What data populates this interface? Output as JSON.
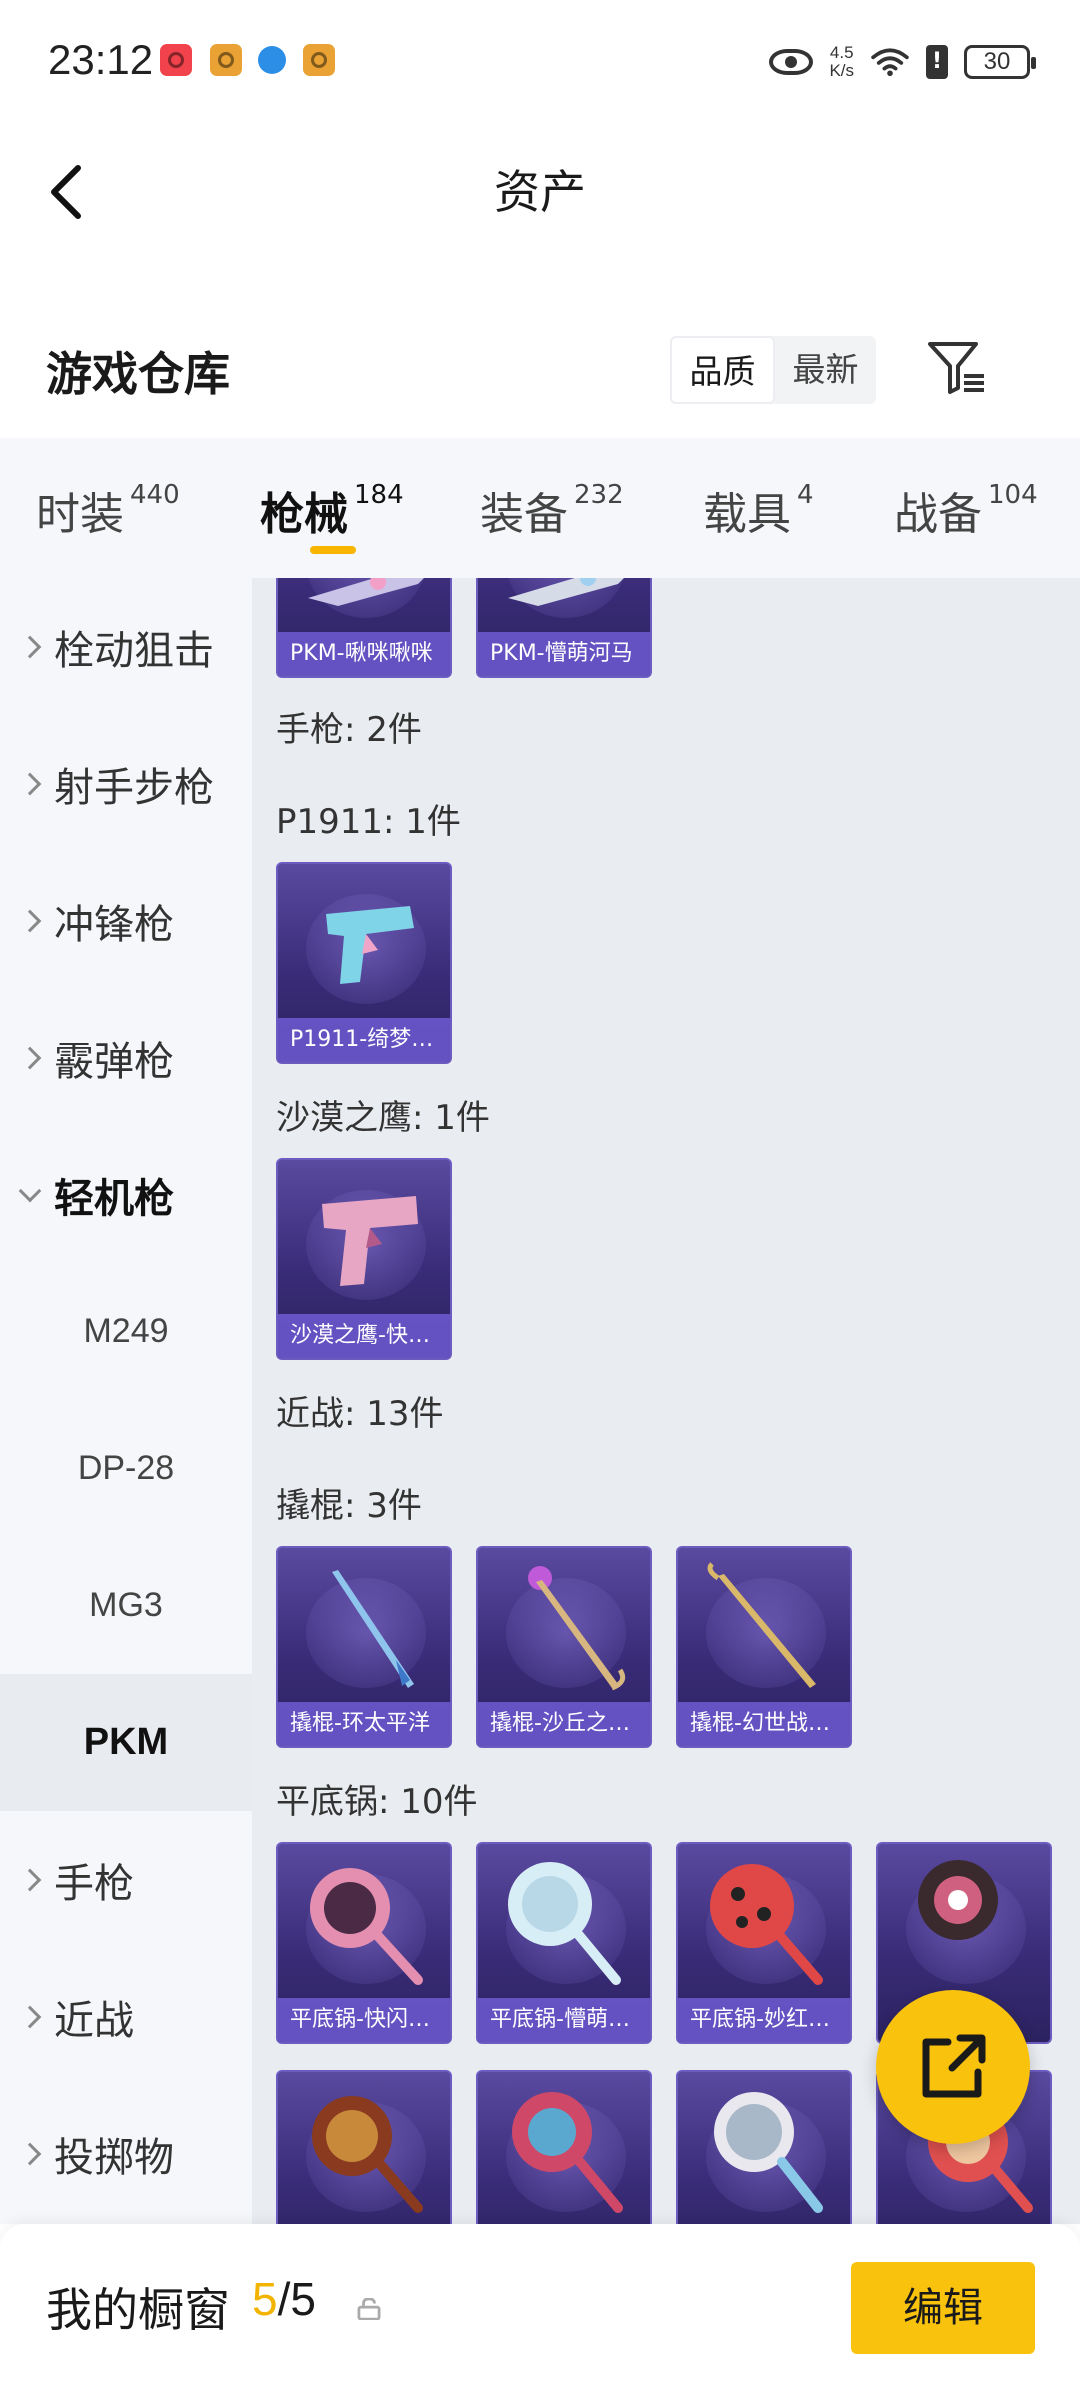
{
  "status_bar": {
    "time": "23:12",
    "net_speed_value": "4.5",
    "net_speed_unit": "K/s",
    "battery": "30",
    "alert_glyph": "!",
    "icons": [
      "notification-app-red-icon",
      "notification-app-orange-icon",
      "notification-app-blue-icon",
      "notification-app-orange-icon",
      "eye-comfort-icon",
      "wifi-icon",
      "alert-icon",
      "battery-icon"
    ]
  },
  "header": {
    "title": "资产",
    "back_icon": "chevron-left-icon"
  },
  "warehouse": {
    "title": "游戏仓库",
    "sort_options": [
      {
        "label": "品质",
        "active": true
      },
      {
        "label": "最新",
        "active": false
      }
    ],
    "filter_icon": "filter-icon"
  },
  "tabs": [
    {
      "label": "时装",
      "count": "440",
      "active": false
    },
    {
      "label": "枪械",
      "count": "184",
      "active": true
    },
    {
      "label": "装备",
      "count": "232",
      "active": false
    },
    {
      "label": "载具",
      "count": "4",
      "active": false
    },
    {
      "label": "战备",
      "count": "104",
      "active": false
    }
  ],
  "sidebar": {
    "items": [
      {
        "label": "栓动狙击"
      },
      {
        "label": "射手步枪"
      },
      {
        "label": "冲锋枪"
      },
      {
        "label": "霰弹枪"
      },
      {
        "label": "轻机枪"
      }
    ],
    "subitems": [
      "M249",
      "DP-28",
      "MG3",
      "PKM"
    ],
    "selected_subitem": "PKM",
    "more_items": [
      {
        "label": "手枪"
      },
      {
        "label": "近战"
      },
      {
        "label": "投掷物"
      }
    ]
  },
  "content": {
    "top_cards": [
      "PKM-啾咪啾咪",
      "PKM-懵萌河马"
    ],
    "sections": {
      "pistol": "手枪: 2件",
      "p1911": "P1911: 1件",
      "deagle": "沙漠之鹰: 1件",
      "melee": "近战: 13件",
      "crowbar": "撬棍: 3件",
      "pan": "平底锅: 10件"
    },
    "p1911_cards": [
      "P1911-绮梦…"
    ],
    "deagle_cards": [
      "沙漠之鹰-快…"
    ],
    "crowbar_cards": [
      "撬棍-环太平洋",
      "撬棍-沙丘之…",
      "撬棍-幻世战…"
    ],
    "pan_cards_row1": [
      "平底锅-快闪…",
      "平底锅-懵萌…",
      "平底锅-妙红…",
      ""
    ],
    "pan_cards_row2": [
      "",
      "",
      "",
      ""
    ]
  },
  "fab": {
    "icon": "share-external-icon"
  },
  "bottom_bar": {
    "label": "我的橱窗",
    "current": "5",
    "total": "/5",
    "lock_icon": "lock-icon",
    "edit_label": "编辑"
  },
  "colors": {
    "accent": "#f8c20d",
    "count_highlight": "#f2b400",
    "card_bg": "#3a2c78",
    "content_bg": "#e9ecf1",
    "sidebar_bg": "#f5f7fa"
  }
}
